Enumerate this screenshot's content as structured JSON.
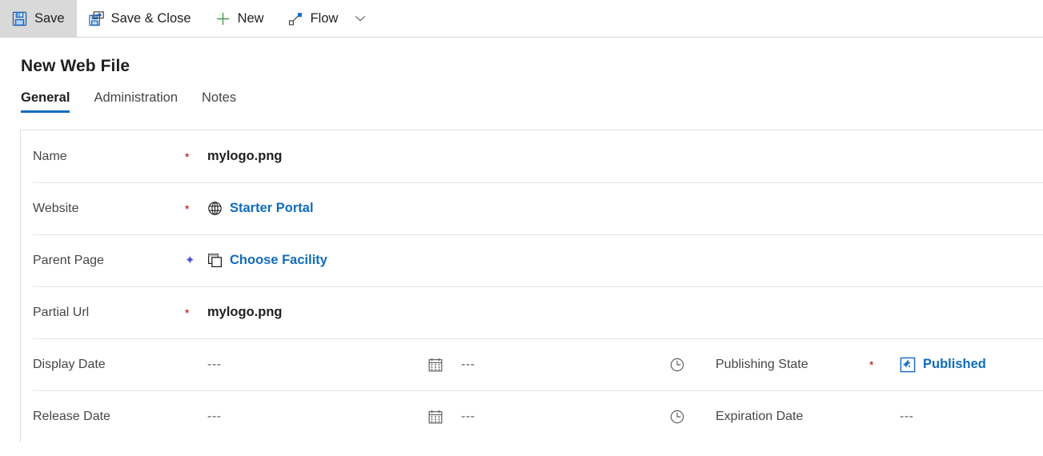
{
  "commandbar": {
    "items": [
      {
        "id": "save",
        "label": "Save",
        "icon": "save-icon",
        "active": true
      },
      {
        "id": "save-close",
        "label": "Save & Close",
        "icon": "save-close-icon",
        "active": false
      },
      {
        "id": "new",
        "label": "New",
        "icon": "plus-icon",
        "active": false
      },
      {
        "id": "flow",
        "label": "Flow",
        "icon": "flow-icon",
        "active": false
      }
    ],
    "overflow_icon": "chevron-down-icon"
  },
  "header": {
    "title": "New Web File"
  },
  "tabs": [
    {
      "label": "General",
      "selected": true
    },
    {
      "label": "Administration",
      "selected": false
    },
    {
      "label": "Notes",
      "selected": false
    }
  ],
  "form": {
    "rows": [
      {
        "id": "name",
        "label": "Name",
        "marker": "required",
        "marker_glyph": "*",
        "value": "mylogo.png",
        "kind": "text"
      },
      {
        "id": "website",
        "label": "Website",
        "marker": "required",
        "marker_glyph": "*",
        "value": "Starter Portal",
        "kind": "lookup",
        "icon": "globe-icon"
      },
      {
        "id": "parent-page",
        "label": "Parent Page",
        "marker": "recommended",
        "marker_glyph": "✦",
        "value": "Choose Facility",
        "kind": "lookup",
        "icon": "pages-icon"
      },
      {
        "id": "partial-url",
        "label": "Partial Url",
        "marker": "required",
        "marker_glyph": "*",
        "value": "mylogo.png",
        "kind": "text"
      }
    ],
    "date_rows": [
      {
        "id": "display-date",
        "label": "Display Date",
        "marker": "none",
        "date_value": "---",
        "date_icon": "calendar-icon",
        "time_value": "---",
        "time_icon": "clock-icon",
        "right_label": "Publishing State",
        "right_marker": "required",
        "right_marker_glyph": "*",
        "right_kind": "lookup",
        "right_icon": "publishing-state-icon",
        "right_value": "Published"
      },
      {
        "id": "release-date",
        "label": "Release Date",
        "marker": "none",
        "date_value": "---",
        "date_icon": "calendar-icon",
        "time_value": "---",
        "time_icon": "clock-icon",
        "right_label": "Expiration Date",
        "right_marker": "none",
        "right_marker_glyph": "",
        "right_kind": "text",
        "right_icon": "",
        "right_value": "---"
      }
    ]
  },
  "colors": {
    "accent": "#0f6cbd",
    "required": "#a80000",
    "recommended": "#4f52cf",
    "label": "#484644",
    "value": "#201f1e",
    "divider": "#e6e4e2",
    "active_bg": "#d9d9d9"
  }
}
